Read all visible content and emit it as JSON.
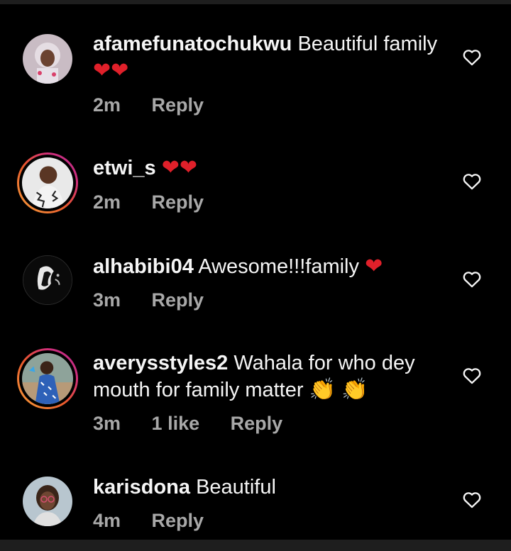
{
  "comments": [
    {
      "username": "afamefunatochukwu",
      "text": "Beautiful family",
      "emojis": [
        "heart",
        "heart"
      ],
      "time": "2m",
      "reply": "Reply",
      "has_story": false
    },
    {
      "username": "etwi_s",
      "text": "",
      "emojis": [
        "heart",
        "heart"
      ],
      "time": "2m",
      "reply": "Reply",
      "has_story": true
    },
    {
      "username": "alhabibi04",
      "text": "Awesome!!!family",
      "emojis": [
        "heart"
      ],
      "time": "3m",
      "reply": "Reply",
      "has_story": false
    },
    {
      "username": "averysstyles2",
      "text": "Wahala for who dey mouth for family matter",
      "emojis": [
        "clapping-hands",
        "clapping-hands"
      ],
      "time": "3m",
      "likes": "1 like",
      "reply": "Reply",
      "has_story": true
    },
    {
      "username": "karisdona",
      "text": "Beautiful",
      "emojis": [],
      "time": "4m",
      "reply": "Reply",
      "has_story": false
    }
  ],
  "emoji_glyphs": {
    "heart": "❤",
    "clap": "👏"
  },
  "colors": {
    "background": "#000000",
    "text": "#f5f5f5",
    "meta": "#a8a8a8",
    "heart": "#e0202a",
    "story_ring": "#d12f7a"
  },
  "icons": {
    "like": "heart-outline-icon"
  }
}
